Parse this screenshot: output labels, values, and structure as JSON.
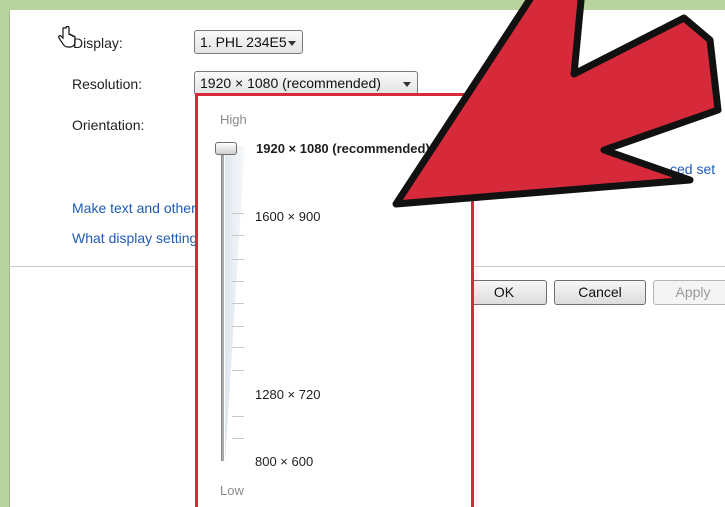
{
  "screen": {
    "display_label": "Display:",
    "display_value": "1. PHL 234E5",
    "resolution_label": "Resolution:",
    "resolution_value": "1920 × 1080 (recommended)",
    "orientation_label": "Orientation:",
    "advanced_link_partial": "ced set",
    "links": {
      "text_size_partial": "Make text and other",
      "display_settings_partial": "What display setting"
    },
    "buttons": {
      "ok": "OK",
      "cancel": "Cancel",
      "apply": "Apply"
    }
  },
  "resolution_dropdown": {
    "high_label": "High",
    "low_label": "Low",
    "options": [
      "1920 × 1080 (recommended)",
      "1600 × 900",
      "1280 × 720",
      "800 × 600"
    ],
    "selected_index": 0
  },
  "colors": {
    "annotation_arrow": "#d62a3a",
    "background": "#b8d39e",
    "link": "#1f5bb5"
  },
  "icons": {
    "cursor": "hand-pointer-icon",
    "dropdown": "chevron-down-icon",
    "annotation": "red-arrow-icon"
  }
}
